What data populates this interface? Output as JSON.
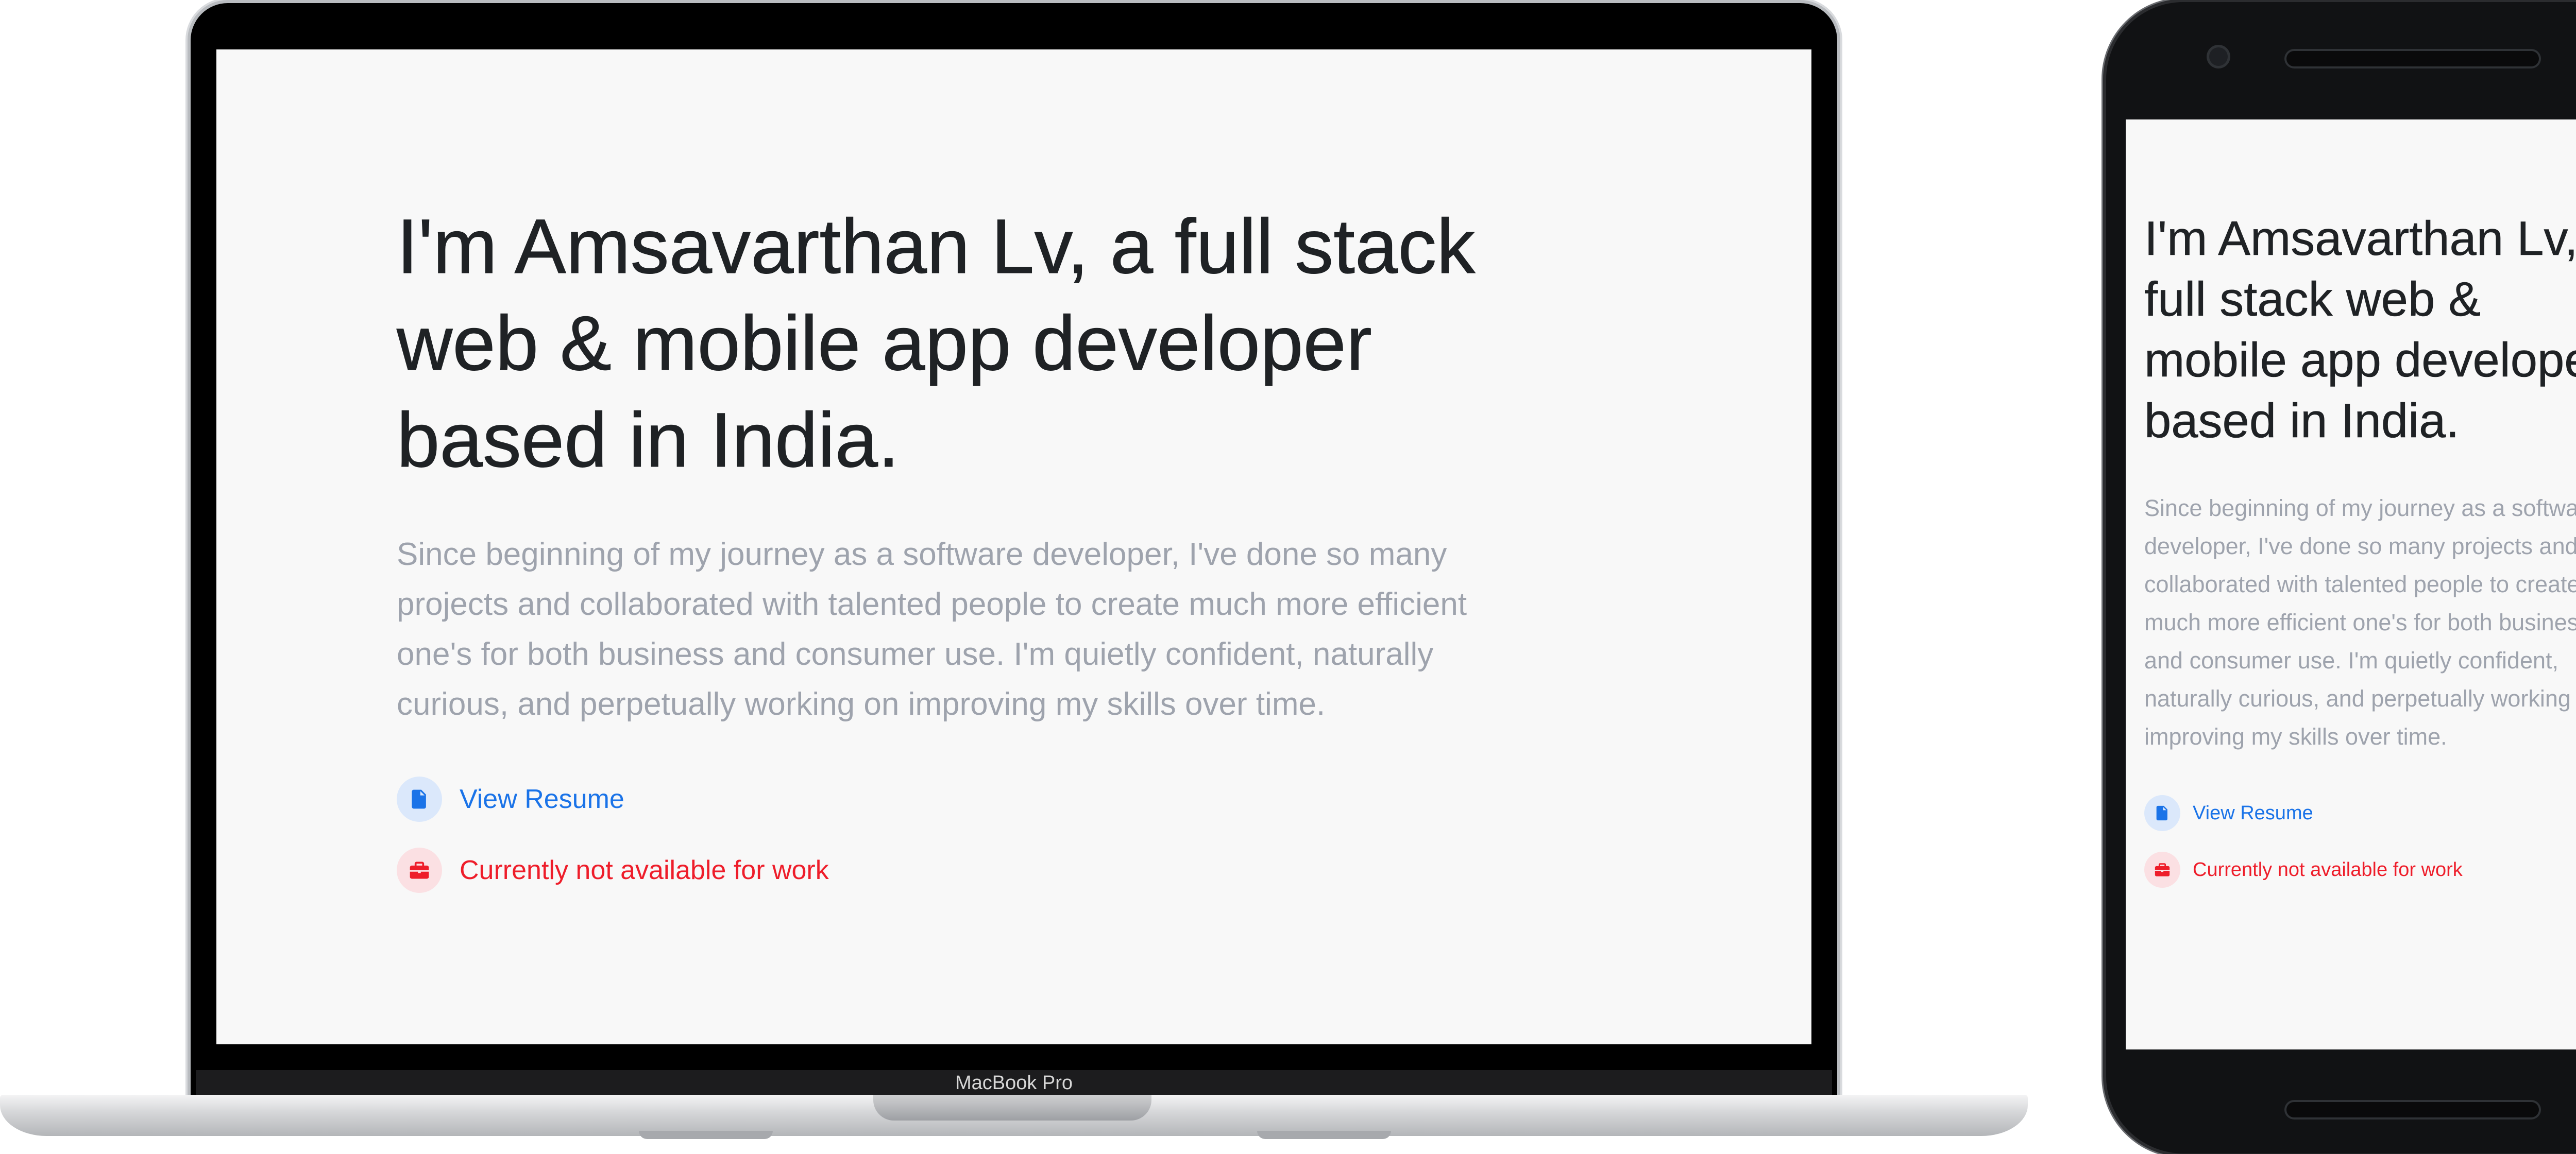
{
  "laptop": {
    "model_label": "MacBook Pro",
    "page": {
      "headline": "I'm Amsavarthan Lv, a full stack web & mobile app developer based in India.",
      "intro": "Since beginning of my journey as a software developer, I've done so many projects and collaborated with talented people to create much more efficient one's for both business and consumer use. I'm quietly confident, naturally curious, and perpetually working on improving my skills over time.",
      "resume_link": {
        "label": "View Resume",
        "icon": "document-icon",
        "color": "#1a73e8"
      },
      "availability": {
        "label": "Currently not available for work",
        "icon": "briefcase-icon",
        "color": "#ee1d2a"
      }
    }
  },
  "phone": {
    "page": {
      "headline": "I'm Amsavarthan Lv, a full stack web & mobile app developer based in India.",
      "intro": "Since beginning of my journey as a software developer, I've done so many projects and collaborated with talented people to create much more efficient one's for both business and consumer use. I'm quietly confident, naturally curious, and perpetually working on improving my skills over time.",
      "resume_link": {
        "label": "View Resume",
        "icon": "document-icon",
        "color": "#1a73e8"
      },
      "availability": {
        "label": "Currently not available for work",
        "icon": "briefcase-icon",
        "color": "#ee1d2a"
      }
    }
  }
}
